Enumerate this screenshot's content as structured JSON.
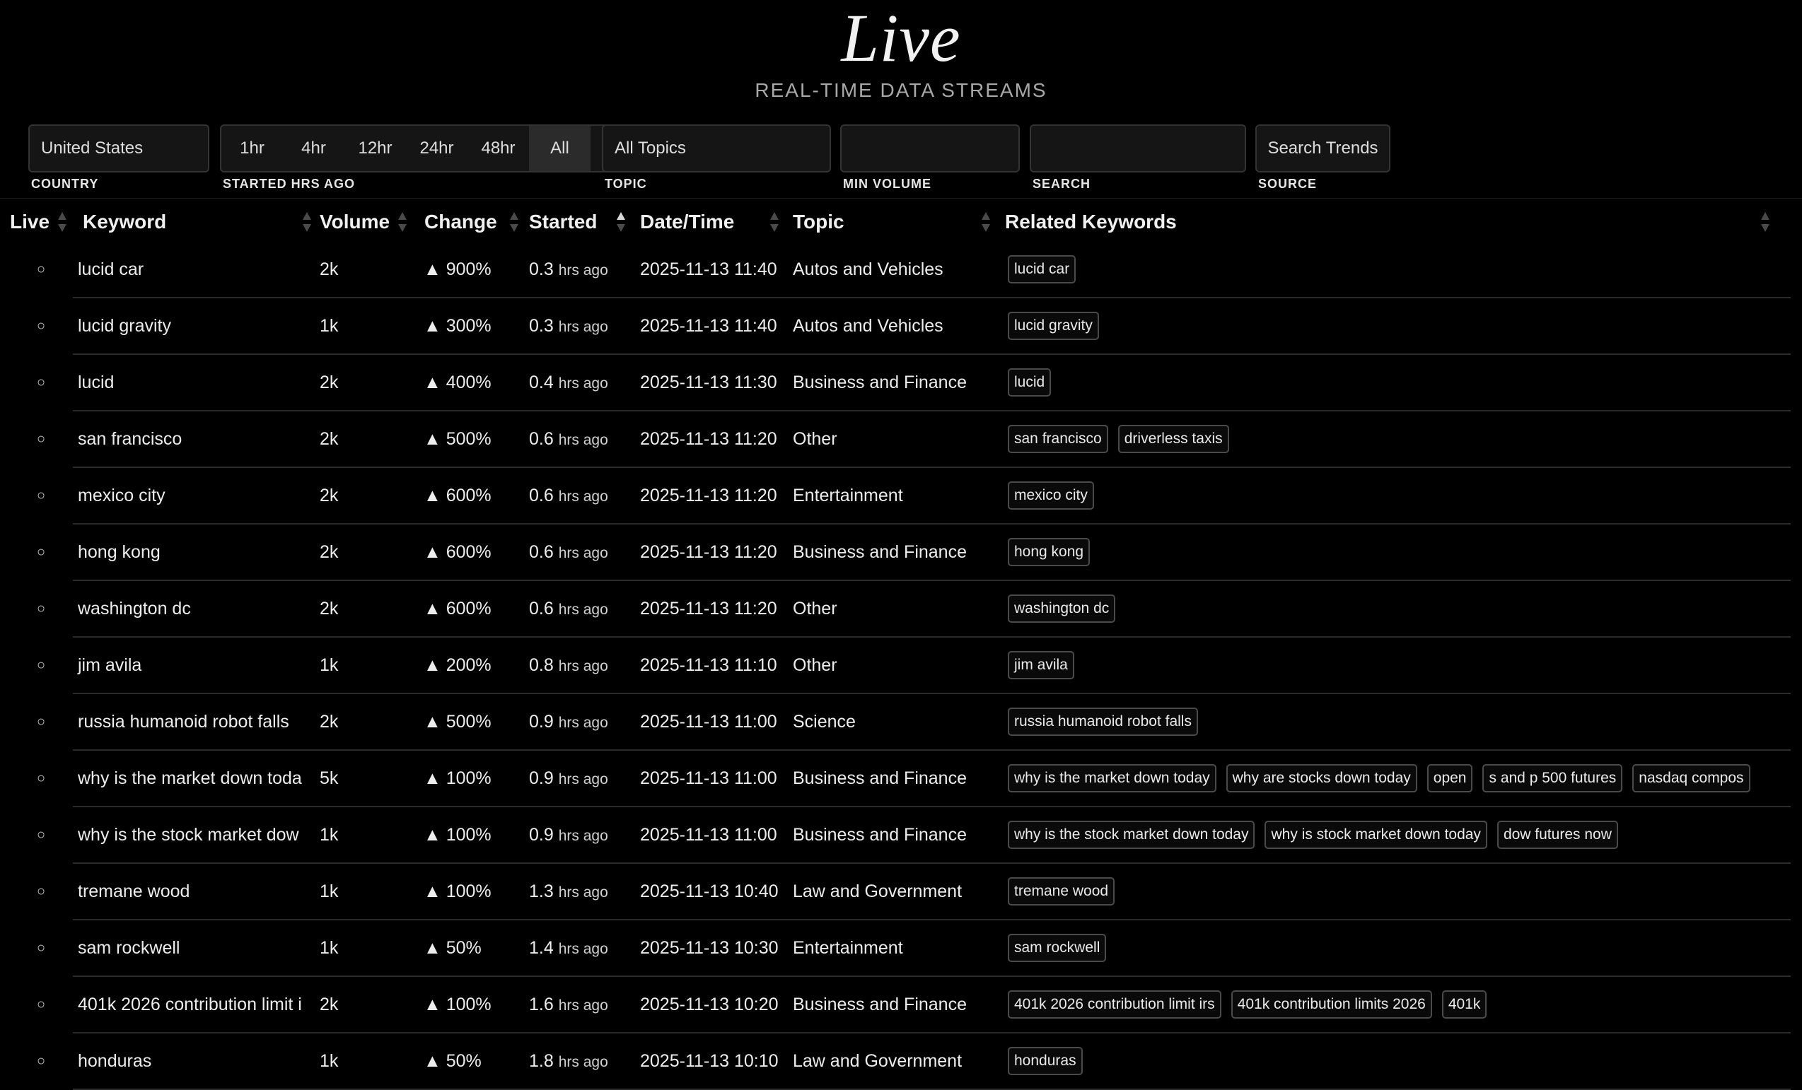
{
  "header": {
    "title": "Live",
    "subtitle": "REAL-TIME DATA STREAMS"
  },
  "filters": {
    "country": {
      "value": "United States",
      "label": "COUNTRY"
    },
    "started": {
      "label": "STARTED HRS AGO",
      "options": [
        "1hr",
        "4hr",
        "12hr",
        "24hr",
        "48hr",
        "All"
      ],
      "selected": "All"
    },
    "topic": {
      "value": "All Topics",
      "label": "TOPIC"
    },
    "min_volume": {
      "value": "",
      "label": "MIN VOLUME"
    },
    "search": {
      "value": "",
      "label": "SEARCH"
    },
    "source": {
      "button": "Search Trends",
      "label": "SOURCE"
    }
  },
  "table": {
    "columns": [
      "Live",
      "Keyword",
      "Volume",
      "Change",
      "Started",
      "Date/Time",
      "Topic",
      "Related Keywords"
    ],
    "sorted_column": "Started",
    "hrs_suffix": "hrs ago",
    "rows": [
      {
        "live": "○",
        "keyword": "lucid car",
        "volume": "2k",
        "change": "▲ 900%",
        "started": "0.3",
        "datetime": "2025-11-13 11:40",
        "topic": "Autos and Vehicles",
        "related": [
          "lucid car"
        ]
      },
      {
        "live": "○",
        "keyword": "lucid gravity",
        "volume": "1k",
        "change": "▲ 300%",
        "started": "0.3",
        "datetime": "2025-11-13 11:40",
        "topic": "Autos and Vehicles",
        "related": [
          "lucid gravity"
        ]
      },
      {
        "live": "○",
        "keyword": "lucid",
        "volume": "2k",
        "change": "▲ 400%",
        "started": "0.4",
        "datetime": "2025-11-13 11:30",
        "topic": "Business and Finance",
        "related": [
          "lucid"
        ]
      },
      {
        "live": "○",
        "keyword": "san francisco",
        "volume": "2k",
        "change": "▲ 500%",
        "started": "0.6",
        "datetime": "2025-11-13 11:20",
        "topic": "Other",
        "related": [
          "san francisco",
          "driverless taxis"
        ]
      },
      {
        "live": "○",
        "keyword": "mexico city",
        "volume": "2k",
        "change": "▲ 600%",
        "started": "0.6",
        "datetime": "2025-11-13 11:20",
        "topic": "Entertainment",
        "related": [
          "mexico city"
        ]
      },
      {
        "live": "○",
        "keyword": "hong kong",
        "volume": "2k",
        "change": "▲ 600%",
        "started": "0.6",
        "datetime": "2025-11-13 11:20",
        "topic": "Business and Finance",
        "related": [
          "hong kong"
        ]
      },
      {
        "live": "○",
        "keyword": "washington dc",
        "volume": "2k",
        "change": "▲ 600%",
        "started": "0.6",
        "datetime": "2025-11-13 11:20",
        "topic": "Other",
        "related": [
          "washington dc"
        ]
      },
      {
        "live": "○",
        "keyword": "jim avila",
        "volume": "1k",
        "change": "▲ 200%",
        "started": "0.8",
        "datetime": "2025-11-13 11:10",
        "topic": "Other",
        "related": [
          "jim avila"
        ]
      },
      {
        "live": "○",
        "keyword": "russia humanoid robot falls",
        "volume": "2k",
        "change": "▲ 500%",
        "started": "0.9",
        "datetime": "2025-11-13 11:00",
        "topic": "Science",
        "related": [
          "russia humanoid robot falls"
        ]
      },
      {
        "live": "○",
        "keyword": "why is the market down toda",
        "volume": "5k",
        "change": "▲ 100%",
        "started": "0.9",
        "datetime": "2025-11-13 11:00",
        "topic": "Business and Finance",
        "related": [
          "why is the market down today",
          "why are stocks down today",
          "open",
          "s and p 500 futures",
          "nasdaq compos"
        ]
      },
      {
        "live": "○",
        "keyword": "why is the stock market dow",
        "volume": "1k",
        "change": "▲ 100%",
        "started": "0.9",
        "datetime": "2025-11-13 11:00",
        "topic": "Business and Finance",
        "related": [
          "why is the stock market down today",
          "why is stock market down today",
          "dow futures now"
        ]
      },
      {
        "live": "○",
        "keyword": "tremane wood",
        "volume": "1k",
        "change": "▲ 100%",
        "started": "1.3",
        "datetime": "2025-11-13 10:40",
        "topic": "Law and Government",
        "related": [
          "tremane wood"
        ]
      },
      {
        "live": "○",
        "keyword": "sam rockwell",
        "volume": "1k",
        "change": "▲ 50%",
        "started": "1.4",
        "datetime": "2025-11-13 10:30",
        "topic": "Entertainment",
        "related": [
          "sam rockwell"
        ]
      },
      {
        "live": "○",
        "keyword": "401k 2026 contribution limit i",
        "volume": "2k",
        "change": "▲ 100%",
        "started": "1.6",
        "datetime": "2025-11-13 10:20",
        "topic": "Business and Finance",
        "related": [
          "401k 2026 contribution limit irs",
          "401k contribution limits 2026",
          "401k"
        ]
      },
      {
        "live": "○",
        "keyword": "honduras",
        "volume": "1k",
        "change": "▲ 50%",
        "started": "1.8",
        "datetime": "2025-11-13 10:10",
        "topic": "Law and Government",
        "related": [
          "honduras"
        ]
      }
    ]
  }
}
